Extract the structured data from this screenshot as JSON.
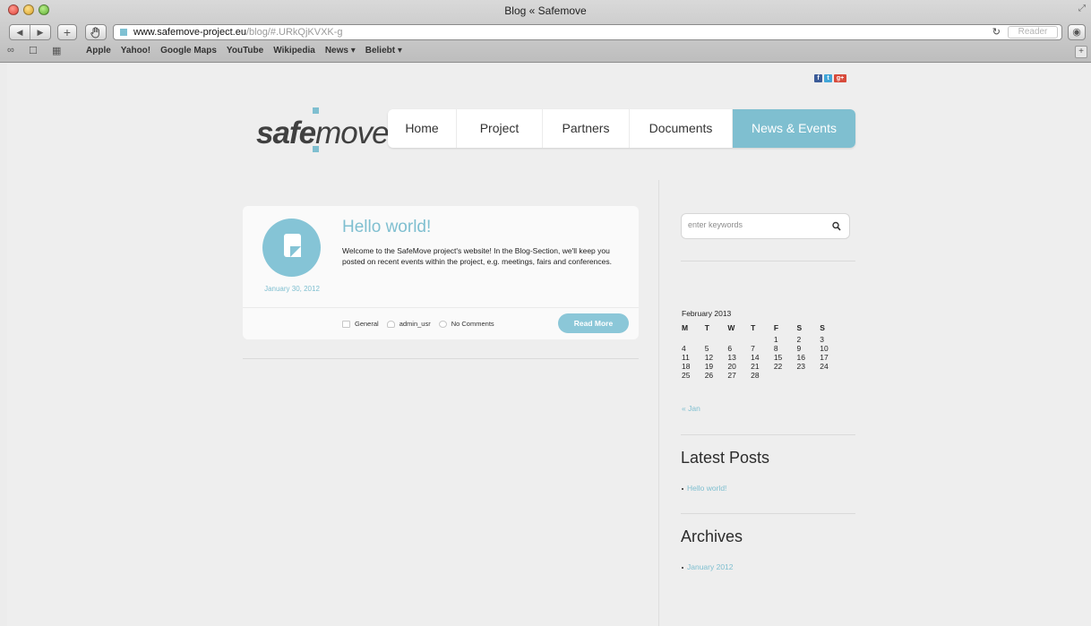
{
  "window": {
    "title": "Blog « Safemove"
  },
  "toolbar": {
    "back_label": "◀",
    "forward_label": "▶",
    "add_label": "+",
    "url_host": "www.safemove-project.eu",
    "url_path": "/blog/#.URkQjKVXK-g",
    "reader_label": "Reader"
  },
  "bookmarks": [
    "Apple",
    "Yahoo!",
    "Google Maps",
    "YouTube",
    "Wikipedia",
    "News ▾",
    "Beliebt ▾"
  ],
  "site": {
    "logo_bold": "safe",
    "logo_light": "move",
    "nav": [
      "Home",
      "Project",
      "Partners",
      "Documents",
      "News & Events"
    ],
    "active_nav": "News & Events"
  },
  "post": {
    "title": "Hello world!",
    "date": "January 30, 2012",
    "excerpt": "Welcome to the SafeMove project's website! In the Blog-Section, we'll keep you posted on recent events within the project, e.g. meetings, fairs and conferences.",
    "category": "General",
    "author": "admin_usr",
    "comments": "No Comments",
    "read_more": "Read More"
  },
  "sidebar": {
    "search_placeholder": "enter keywords",
    "calendar": {
      "caption": "February 2013",
      "weekdays": [
        "M",
        "T",
        "W",
        "T",
        "F",
        "S",
        "S"
      ],
      "weeks": [
        [
          "",
          "",
          "",
          "",
          "1",
          "2",
          "3"
        ],
        [
          "4",
          "5",
          "6",
          "7",
          "8",
          "9",
          "10"
        ],
        [
          "11",
          "12",
          "13",
          "14",
          "15",
          "16",
          "17"
        ],
        [
          "18",
          "19",
          "20",
          "21",
          "22",
          "23",
          "24"
        ],
        [
          "25",
          "26",
          "27",
          "28",
          "",
          "",
          ""
        ]
      ],
      "prev_link": "« Jan"
    },
    "latest_posts_title": "Latest Posts",
    "latest_posts": [
      "Hello world!"
    ],
    "archives_title": "Archives",
    "archives": [
      "January 2012"
    ]
  },
  "colors": {
    "accent": "#7fbfd0",
    "text": "#2c2c2c",
    "background": "#eeeeee"
  }
}
